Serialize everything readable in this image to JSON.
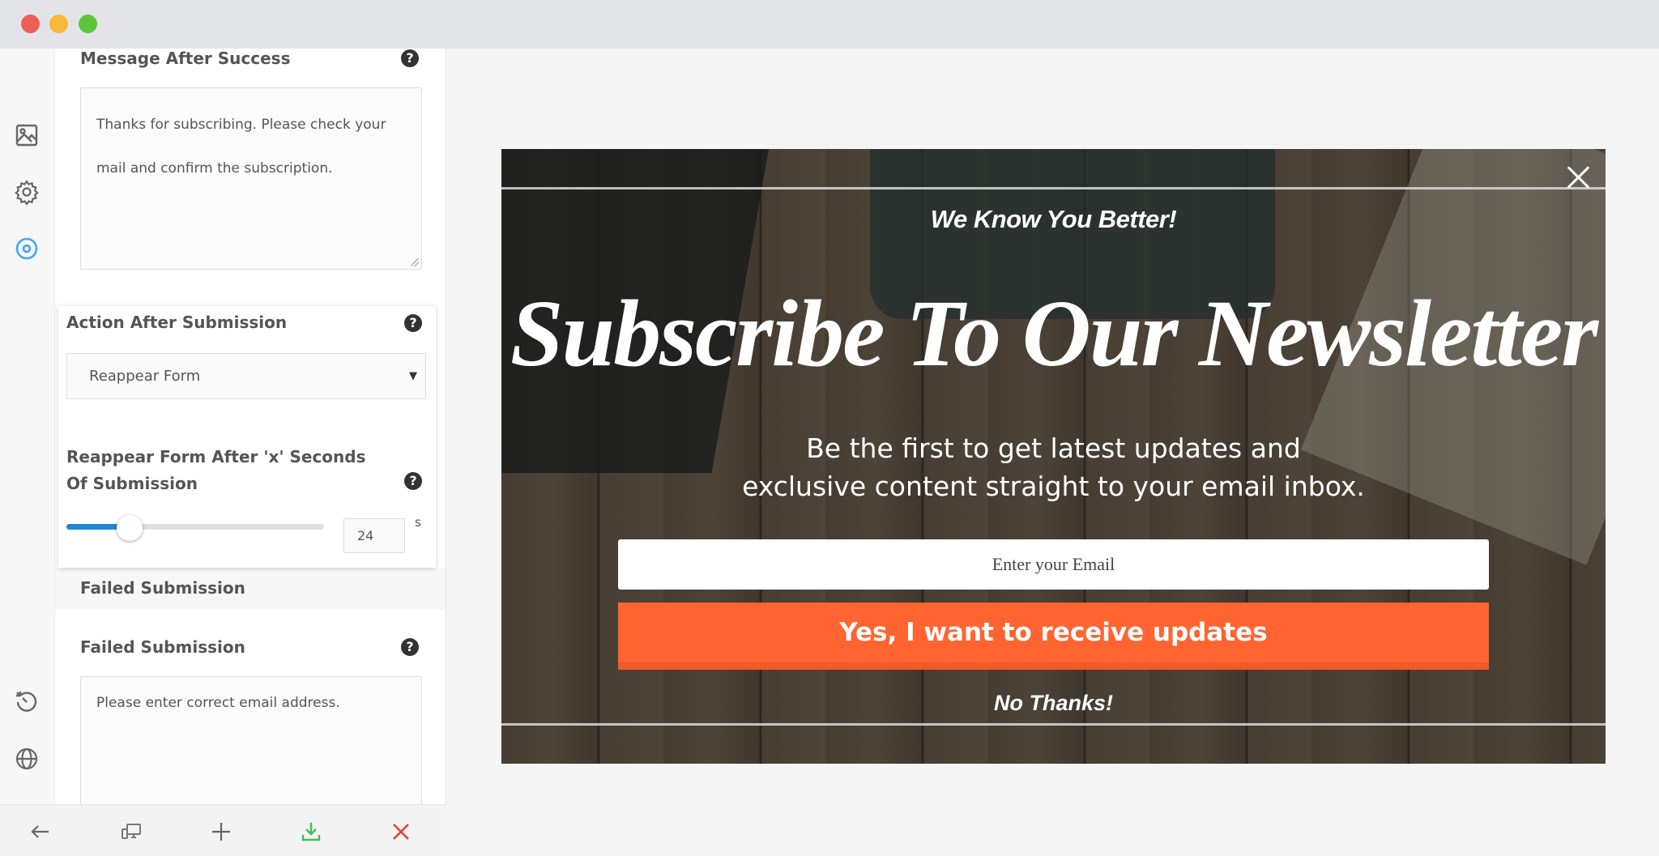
{
  "window": {
    "controls": [
      "close",
      "minimize",
      "maximize"
    ]
  },
  "rail": {
    "top_icons": [
      {
        "name": "image-icon",
        "active": false
      },
      {
        "name": "gear-icon",
        "active": false
      },
      {
        "name": "target-icon",
        "active": true
      }
    ],
    "bottom_icons": [
      {
        "name": "history-icon"
      },
      {
        "name": "globe-icon"
      }
    ],
    "active_color": "#42a5f5"
  },
  "panel": {
    "message_after_success": {
      "label": "Message After Success",
      "help": "?",
      "value": "Thanks for subscribing. Please check your mail and confirm the subscription."
    },
    "action_after_submission": {
      "label": "Action After Submission",
      "help": "?",
      "selected": "Reappear Form",
      "caret": "▼"
    },
    "reappear_delay": {
      "label": "Reappear Form After 'x' Seconds Of Submission",
      "help": "?",
      "value": "24",
      "unit": "s",
      "slider_fraction": 0.245
    },
    "failed_section": {
      "title": "Failed Submission"
    },
    "failed_submission": {
      "label": "Failed Submission",
      "help": "?",
      "value": "Please enter correct email address."
    }
  },
  "footer": {
    "buttons": [
      {
        "name": "back-arrow-icon",
        "color": "#666666"
      },
      {
        "name": "responsive-devices-icon",
        "color": "#777777"
      },
      {
        "name": "plus-icon",
        "color": "#666666"
      },
      {
        "name": "download-icon",
        "color": "#3fbf5f"
      },
      {
        "name": "close-icon",
        "color": "#e53935"
      }
    ]
  },
  "popup": {
    "close": "×",
    "eyebrow": "We Know You Better!",
    "headline": "Subscribe To Our Newsletter",
    "subtext_line1": "Be the first to get latest updates and",
    "subtext_line2": "exclusive content straight to your email inbox.",
    "email_placeholder": "Enter your Email",
    "cta_label": "Yes, I want to receive updates",
    "cta_color": "#ff6431",
    "decline_label": "No Thanks!"
  }
}
